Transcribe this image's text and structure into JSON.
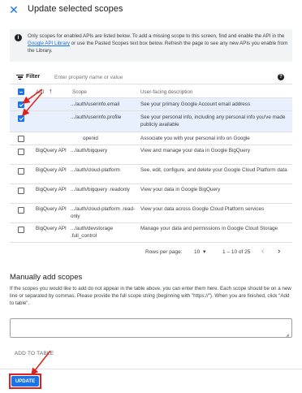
{
  "header": {
    "close_icon": "close-icon",
    "title": "Update selected scopes"
  },
  "info": {
    "icon": "info-icon",
    "text_before": "Only scopes for enabled APIs are listed below. To add a missing scope to this screen, find and enable the API in the ",
    "link": "Google API Library",
    "text_after": " or use the Pasted Scopes text box below. Refresh the page to see any new APIs you enable from the Library."
  },
  "filter": {
    "icon": "filter-icon",
    "label": "Filter",
    "placeholder": "Enter property name or value",
    "help_icon": "help-icon"
  },
  "table": {
    "headers": {
      "api": "API",
      "scope": "Scope",
      "description": "User-facing description"
    },
    "sort_icon": "arrow-up-icon",
    "header_checkbox": "indeterminate",
    "rows": [
      {
        "api": "",
        "scope": ".../auth/userinfo.email",
        "description": "See your primary Google Account email address",
        "checked": true
      },
      {
        "api": "",
        "scope": ".../auth/userinfo.profile",
        "description": "See your personal info, including any personal info you've made publicly available",
        "checked": true
      },
      {
        "api": "",
        "scope": "openid",
        "description": "Associate you with your personal info on Google",
        "checked": false
      },
      {
        "api": "BigQuery API",
        "scope": ".../auth/bigquery",
        "description": "View and manage your data in Google BigQuery",
        "checked": false
      },
      {
        "api": "BigQuery API",
        "scope": ".../auth/cloud-platform",
        "description": "See, edit, configure, and delete your Google Cloud Platform data",
        "checked": false
      },
      {
        "api": "BigQuery API",
        "scope": ".../auth/bigquery .readonly",
        "description": "View your data in Google BigQuery",
        "checked": false
      },
      {
        "api": "BigQuery API",
        "scope": ".../auth/cloud-platform .read-only",
        "description": "View your data across Google Cloud Platform services",
        "checked": false
      },
      {
        "api": "BigQuery API",
        "scope": ".../auth/devstorage .full_control",
        "description": "Manage your data and permissions in Google Cloud Storage",
        "checked": false
      }
    ]
  },
  "pagination": {
    "rows_per_page_label": "Rows per page:",
    "rows_per_page_value": "10",
    "range": "1 – 10 of 25",
    "prev_icon": "chevron-left-icon",
    "next_icon": "chevron-right-icon"
  },
  "manual": {
    "title": "Manually add scopes",
    "description": "If the scopes you would like to add do not appear in the table above, you can enter them here. Each scope should be on a new line or separated by commas. Please provide the full scope string (beginning with \"https://\"). When you are finished, click \"Add to table\".",
    "textarea_value": "",
    "add_button": "ADD TO TABLE"
  },
  "footer": {
    "update_button": "UPDATE"
  },
  "colors": {
    "accent": "#1a73e8",
    "selected_row": "#e8f0fe",
    "annotation": "#e0201b"
  }
}
